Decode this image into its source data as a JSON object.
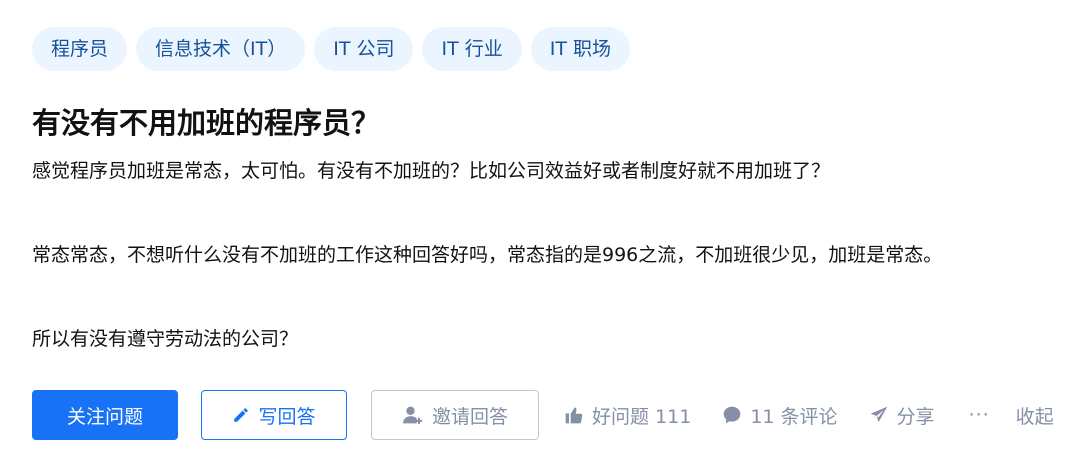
{
  "topics": [
    {
      "label": "程序员"
    },
    {
      "label": "信息技术（IT）"
    },
    {
      "label": "IT 公司"
    },
    {
      "label": "IT 行业"
    },
    {
      "label": "IT 职场"
    }
  ],
  "question": {
    "title": "有没有不用加班的程序员？",
    "paragraphs": [
      "感觉程序员加班是常态，太可怕。有没有不加班的？比如公司效益好或者制度好就不用加班了？",
      "常态常态，不想听什么没有不加班的工作这种回答好吗，常态指的是996之流，不加班很少见，加班是常态。",
      "所以有没有遵守劳动法的公司？"
    ]
  },
  "actions": {
    "follow_label": "关注问题",
    "write_answer_label": "写回答",
    "invite_label": "邀请回答",
    "good_question_label": "好问题 111",
    "comments_label": "11 条评论",
    "share_label": "分享",
    "more_label": "···",
    "collapse_label": "收起"
  },
  "icons": {
    "write": "pencil-icon",
    "invite": "add-user-icon",
    "like": "thumbs-up-icon",
    "comment": "comment-bubble-icon",
    "share": "paper-plane-icon"
  },
  "colors": {
    "accent": "#1772f6",
    "tag_bg": "#ebf5ff",
    "tag_text": "#175199",
    "muted": "#8590a6"
  }
}
